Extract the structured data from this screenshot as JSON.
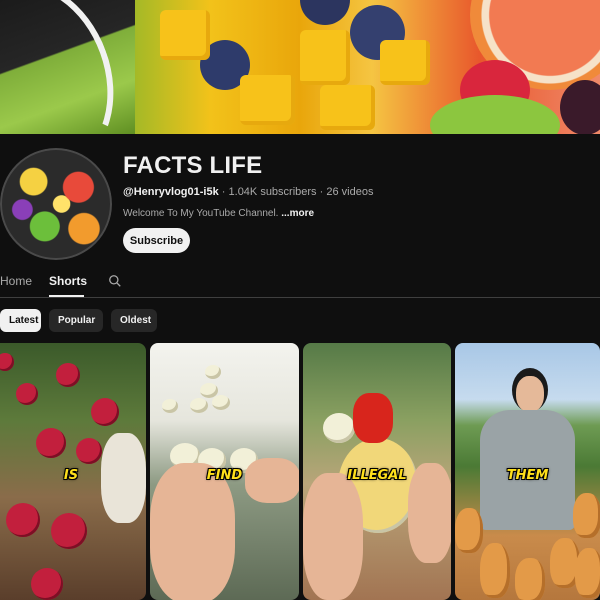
{
  "channel": {
    "title": "FACTS LIFE",
    "handle": "@Henryvlog01-i5k",
    "subscribers": "1.04K subscribers",
    "videos": "26 videos",
    "description": "Welcome To My YouTube Channel.",
    "more_label": "...more",
    "subscribe_label": "Subscribe"
  },
  "tabs": [
    {
      "label": "Home",
      "active": false
    },
    {
      "label": "Shorts",
      "active": true
    }
  ],
  "search_icon": "search-icon",
  "filters": [
    {
      "label": "Latest",
      "active": true
    },
    {
      "label": "Popular",
      "active": false
    },
    {
      "label": "Oldest",
      "active": false
    }
  ],
  "shorts": [
    {
      "caption": "IS"
    },
    {
      "caption": "FIND"
    },
    {
      "caption": "ILLEGAL"
    },
    {
      "caption": "THEM"
    }
  ],
  "colors": {
    "background": "#0f0f0f",
    "text_primary": "#f1f1f1",
    "text_secondary": "#aaaaaa",
    "chip_bg": "#272727",
    "caption": "#ffe01b"
  }
}
